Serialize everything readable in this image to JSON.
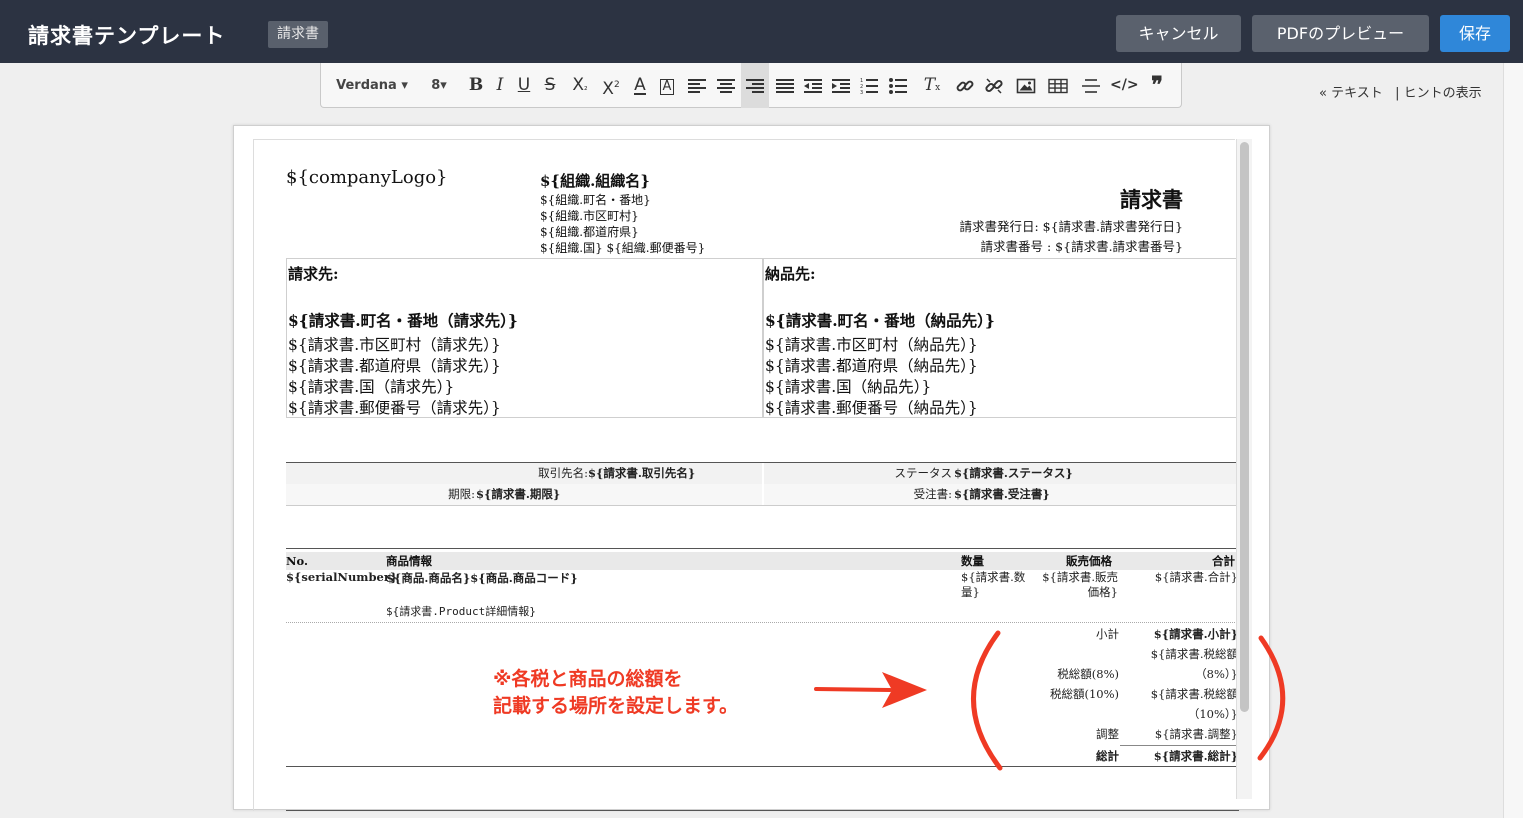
{
  "header": {
    "title": "請求書テンプレート",
    "badge": "請求書",
    "cancel_label": "キャンセル",
    "preview_label": "PDFのプレビュー",
    "save_label": "保存"
  },
  "toolbar": {
    "font": "Verdana",
    "size": "8"
  },
  "side_links": {
    "text_mode": "« テキスト",
    "separator": "|",
    "hints": "ヒントの表示"
  },
  "document": {
    "logo": "${companyLogo}",
    "org": {
      "name": "${組織.組織名}",
      "street": "${組織.町名・番地}",
      "city": "${組織.市区町村}",
      "state": "${組織.都道府県}",
      "country_zip": "${組織.国} ${組織.郵便番号}"
    },
    "invoice_title": "請求書",
    "issue_date": "請求書発行日: ${請求書.請求書発行日}",
    "invoice_no": "請求書番号 : ${請求書.請求書番号}",
    "bill": {
      "heading": "請求先:",
      "street": "${請求書.町名・番地（請求先）}",
      "city": "${請求書.市区町村（請求先）}",
      "state": "${請求書.都道府県（請求先）}",
      "country": "${請求書.国（請求先）}",
      "zip": "${請求書.郵便番号（請求先）}"
    },
    "ship": {
      "heading": "納品先:",
      "street": "${請求書.町名・番地（納品先）}",
      "city": "${請求書.市区町村（納品先）}",
      "state": "${請求書.都道府県（納品先）}",
      "country": "${請求書.国（納品先）}",
      "zip": "${請求書.郵便番号（納品先）}"
    },
    "info": {
      "account_label": "取引先名:",
      "account_value": "${請求書.取引先名}",
      "status_label": "ステータス",
      "status_value": "${請求書.ステータス}",
      "due_label": "期限:",
      "due_value": "${請求書.期限}",
      "order_label": "受注書:",
      "order_value": "${請求書.受注書}"
    },
    "items_table": {
      "headers": [
        "No.",
        "商品情報",
        "数量",
        "販売価格",
        "合計"
      ],
      "row": {
        "serial": "${serialNumber}",
        "product": "${商品.商品名}${商品.商品コード}",
        "qty_1": "${請求書.数",
        "qty_2": "量}",
        "price_1": "${請求書.販売",
        "price_2": "価格}",
        "total": "${請求書.合計}",
        "detail": "${請求書.Product詳細情報}"
      }
    },
    "summary": {
      "subtotal_label": "小計",
      "subtotal_value": "${請求書.小計}",
      "tax8_label": "税総額(8%)",
      "tax8_value_1": "${請求書.税総額",
      "tax8_value_2": "（8%）}",
      "tax10_label": "税総額(10%)",
      "tax10_value_1": "${請求書.税総額",
      "tax10_value_2": "（10%）}",
      "adjust_label": "調整",
      "adjust_value": "${請求書.調整}",
      "total_label": "総計",
      "total_value": "${請求書.総計}"
    }
  },
  "annotation": {
    "line1": "※各税と商品の総額を",
    "line2": "記載する場所を設定します。",
    "color": "#ef3a24"
  }
}
